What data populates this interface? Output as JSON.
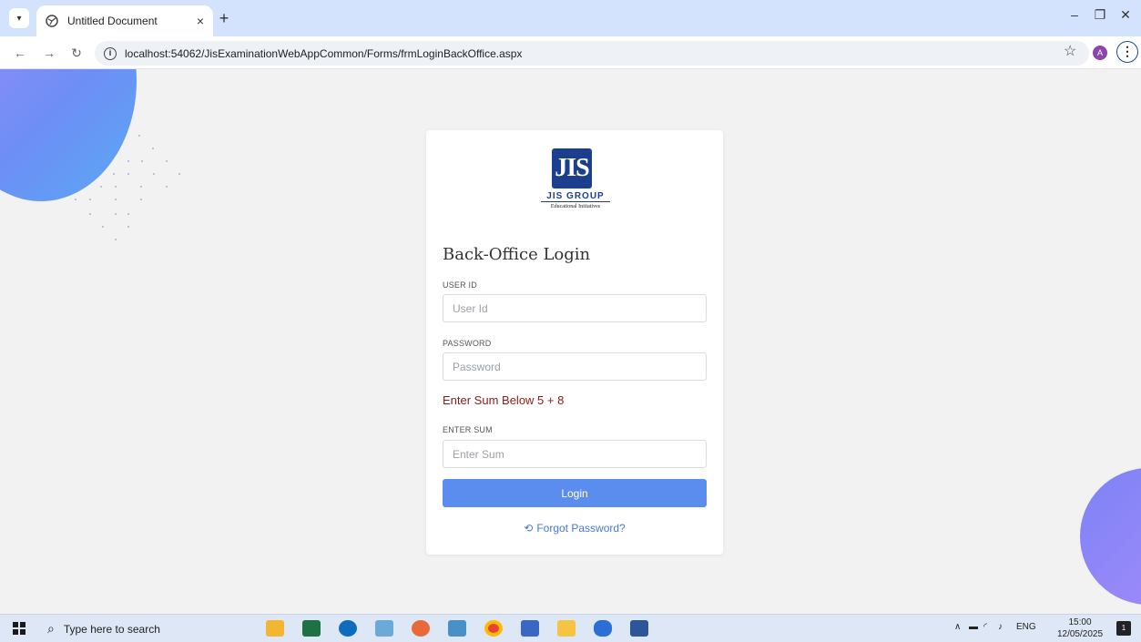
{
  "browser": {
    "tab_title": "Untitled Document",
    "tab_close": "×",
    "new_tab": "+",
    "url": "localhost:54062/JisExaminationWebAppCommon/Forms/frmLoginBackOffice.aspx",
    "avatar_letter": "A"
  },
  "logo": {
    "mark": "JIS",
    "group": "JIS GROUP",
    "tagline": "Educational Initiatives"
  },
  "login": {
    "title": "Back-Office Login",
    "user_id_label": "USER ID",
    "user_id_placeholder": "User Id",
    "password_label": "PASSWORD",
    "password_placeholder": "Password",
    "captcha_text": "Enter Sum Below 5 + 8",
    "sum_label": "ENTER SUM",
    "sum_placeholder": "Enter Sum",
    "login_button": "Login",
    "forgot_link": "Forgot Password?"
  },
  "taskbar": {
    "search_placeholder": "Type here to search",
    "language": "ENG",
    "time": "15:00",
    "date": "12/05/2025",
    "notification_count": "1"
  },
  "colors": {
    "accent": "#5b8def",
    "captcha": "#8b1a1a",
    "link": "#4a76d9",
    "logo_blue": "#1b3f8c"
  }
}
